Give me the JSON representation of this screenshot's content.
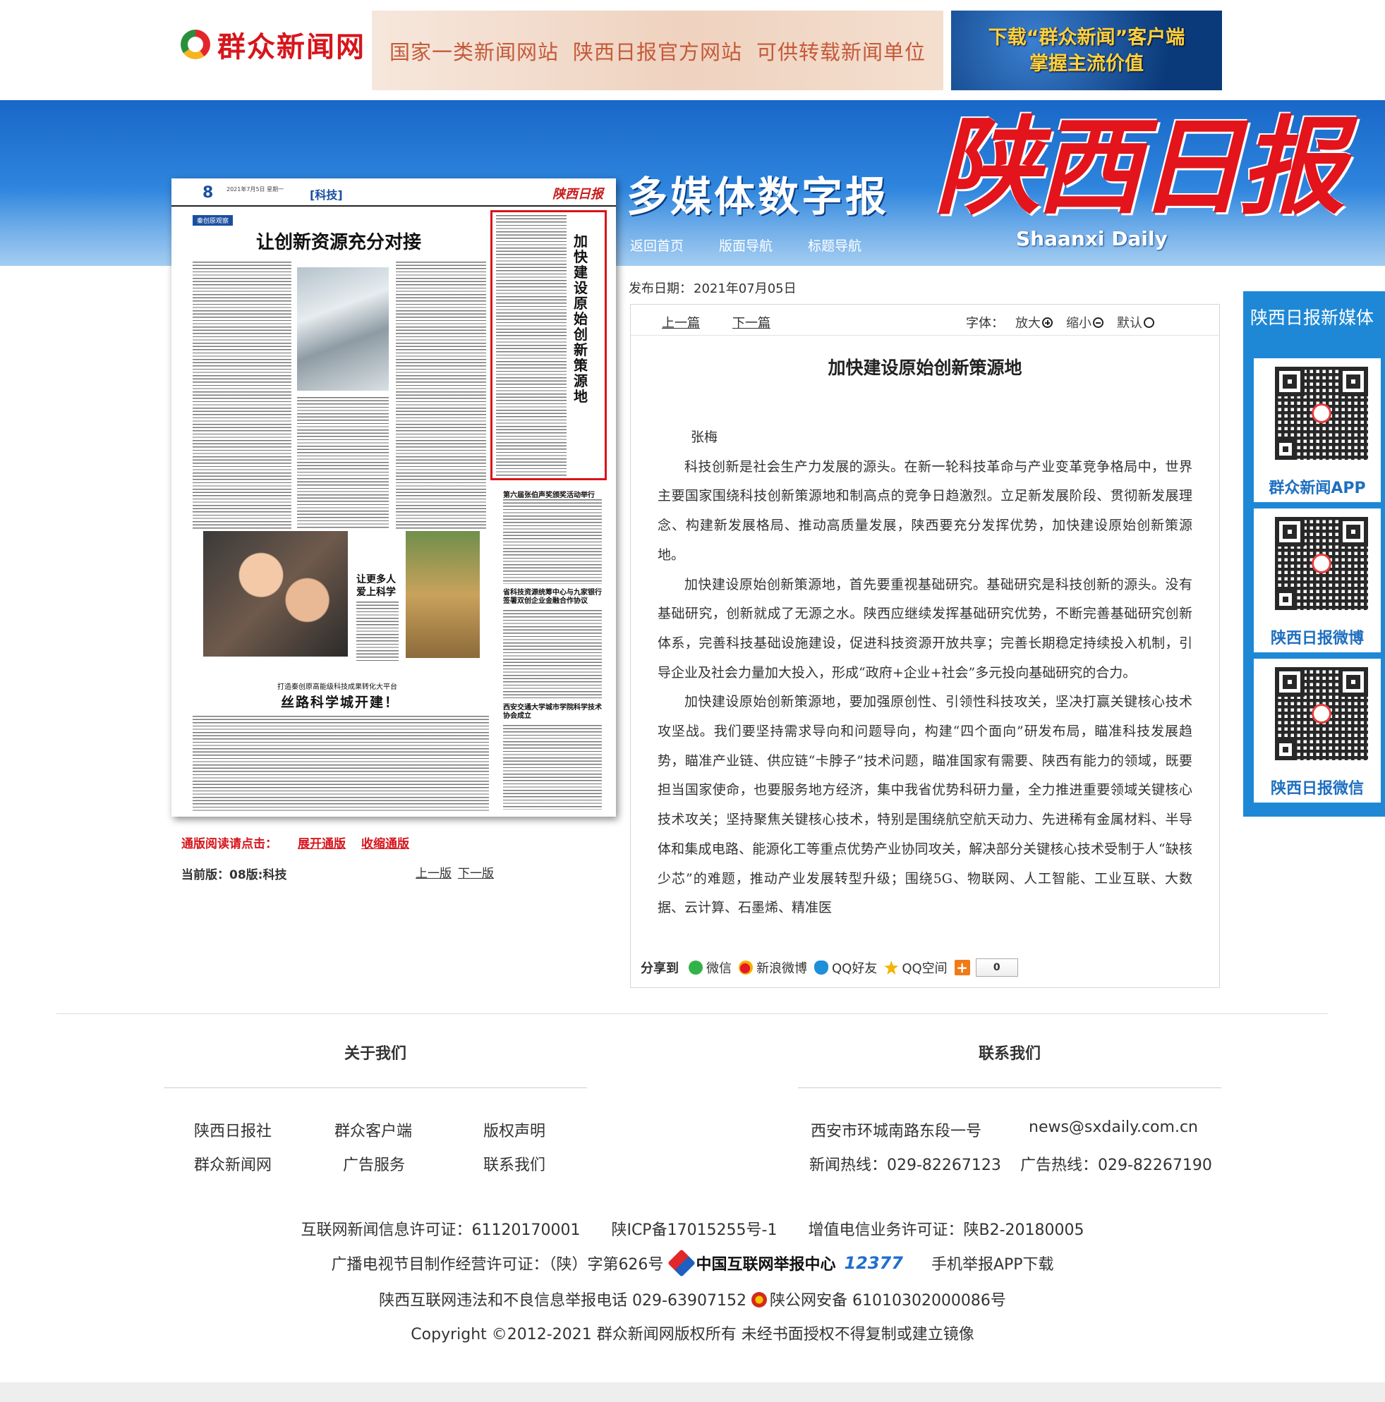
{
  "top": {
    "logo_text": "群众新闻网",
    "slogans": [
      "国家一类新闻网站",
      "陕西日报官方网站",
      "可供转载新闻单位"
    ],
    "download_line1": "下载“群众新闻”客户端",
    "download_line2": "掌握主流价值"
  },
  "header": {
    "multimedia_title": "多媒体数字报",
    "masthead": "陕西日报",
    "masthead_en": "Shaanxi Daily",
    "nav": [
      "返回首页",
      "版面导航",
      "标题导航"
    ]
  },
  "newspaper": {
    "page_no": "8",
    "date_line": "2021年7月5日 星期一",
    "section": "[科技]",
    "brand": "陕西日报",
    "tag": "秦创原观察",
    "headline": "让创新资源充分对接",
    "kids_title": "让更多人爱上科学",
    "silk_sub": "打造秦创原高能级科技成果转化大平台",
    "silk_title": "丝路科学城开建！",
    "vertical_title": "加快建设原始创新策源地",
    "sub_1": "第六届张伯声奖颁奖活动举行",
    "sub_2": "省科技资源统筹中心与九家银行签署双创企业金融合作协议",
    "sub_3": "西安交通大学城市学院科学技术协会成立"
  },
  "page_controls": {
    "full_read_label": "通版阅读请点击：",
    "expand": "展开通版",
    "collapse": "收缩通版",
    "current_page": "当前版：08版:科技",
    "prev_page": "上一版",
    "next_page": "下一版"
  },
  "article": {
    "pub_date_label": "发布日期：",
    "pub_date": "2021年07月05日",
    "prev": "上一篇",
    "next": "下一篇",
    "font_label": "字体：",
    "zoom_in": "放大",
    "zoom_out": "缩小",
    "font_default": "默认",
    "title": "加快建设原始创新策源地",
    "author": "张梅",
    "paragraphs": [
      "科技创新是社会生产力发展的源头。在新一轮科技革命与产业变革竞争格局中，世界主要国家围绕科技创新策源地和制高点的竞争日趋激烈。立足新发展阶段、贯彻新发展理念、构建新发展格局、推动高质量发展，陕西要充分发挥优势，加快建设原始创新策源地。",
      "加快建设原始创新策源地，首先要重视基础研究。基础研究是科技创新的源头。没有基础研究，创新就成了无源之水。陕西应继续发挥基础研究优势，不断完善基础研究创新体系，完善科技基础设施建设，促进科技资源开放共享；完善长期稳定持续投入机制，引导企业及社会力量加大投入，形成“政府+企业+社会”多元投向基础研究的合力。",
      "加快建设原始创新策源地，要加强原创性、引领性科技攻关，坚决打赢关键核心技术攻坚战。我们要坚持需求导向和问题导向，构建“四个面向”研发布局，瞄准科技发展趋势，瞄准产业链、供应链“卡脖子”技术问题，瞄准国家有需要、陕西有能力的领域，既要担当国家使命，也要服务地方经济，集中我省优势科研力量，全力推进重要领域关键核心技术攻关；坚持聚焦关键核心技术，特别是围绕航空航天动力、先进稀有金属材料、半导体和集成电路、能源化工等重点优势产业协同攻关，解决部分关键核心技术受制于人“缺核少芯”的难题，推动产业发展转型升级；围绕5G、物联网、人工智能、工业互联、大数据、云计算、石墨烯、精准医"
    ],
    "share_label": "分享到",
    "share_items": [
      "微信",
      "新浪微博",
      "QQ好友",
      "QQ空间"
    ],
    "share_count": "0"
  },
  "media": {
    "title": "陕西日报新媒体",
    "items": [
      "群众新闻APP",
      "陕西日报微博",
      "陕西日报微信"
    ]
  },
  "footer": {
    "about_title": "关于我们",
    "contact_title": "联系我们",
    "about_links": [
      "陕西日报社",
      "群众客户端",
      "版权声明",
      "群众新闻网",
      "广告服务",
      "联系我们"
    ],
    "address": "西安市环城南路东段一号",
    "email": "news@sxdaily.com.cn",
    "news_hotline": "新闻热线：029-82267123",
    "ad_hotline": "广告热线：029-82267190",
    "legal_1": "互联网新闻信息许可证：61120170001　　陕ICP备17015255号-1　　增值电信业务许可证：陕B2-20180005",
    "legal_2a": "广播电视节目制作经营许可证：（陕）字第626号",
    "report_center": "中国互联网举报中心",
    "badge_12377": "12377",
    "legal_2b": "手机举报APP下载",
    "legal_3a": "陕西互联网违法和不良信息举报电话 029-63907152",
    "legal_3b": "陕公网安备 61010302000086号",
    "copyright": "Copyright ©2012-2021 群众新闻网版权所有 未经书面授权不得复制或建立镜像"
  }
}
